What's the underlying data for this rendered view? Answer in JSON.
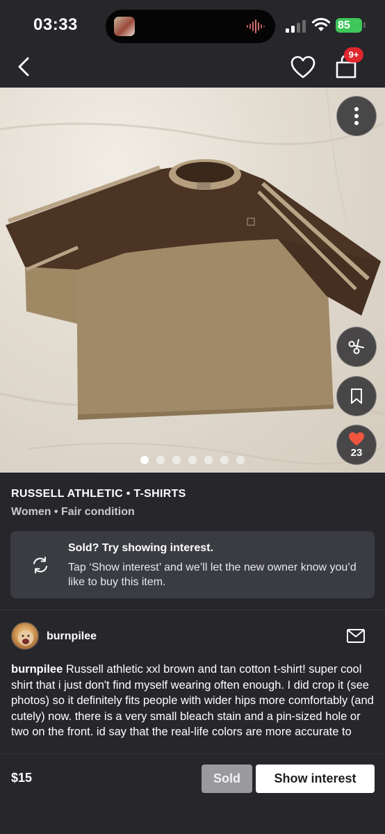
{
  "status_bar": {
    "time": "03:33",
    "battery": "85"
  },
  "nav": {
    "cart_badge": "9+"
  },
  "photo": {
    "image_count": 7,
    "active_index": 0,
    "like_count": "23"
  },
  "product": {
    "brand_category": "RUSSELL ATHLETIC • T-SHIRTS",
    "meta": "Women • Fair condition"
  },
  "interest_card": {
    "title": "Sold? Try showing interest.",
    "text": "Tap ‘Show interest’ and we’ll let the new owner know you’d like to buy this item."
  },
  "seller": {
    "username": "burnpilee"
  },
  "description": {
    "author": "burnpilee",
    "text": " Russell athletic xxl brown and tan cotton t-shirt! super cool shirt that i just don't find myself wearing often enough. I did crop it (see photos) so it definitely fits people with wider hips more comfortably (and cutely) now. there is a very small bleach stain and a pin-sized hole or two on the front. id say that the real-life colors are more accurate to"
  },
  "bottom_bar": {
    "price": "$15",
    "sold_label": "Sold",
    "show_interest_label": "Show interest"
  },
  "colors": {
    "background": "#26262b",
    "card": "#3a3c42",
    "badge": "#e0262e",
    "heart": "#f0553f",
    "battery": "#3fc75a"
  }
}
